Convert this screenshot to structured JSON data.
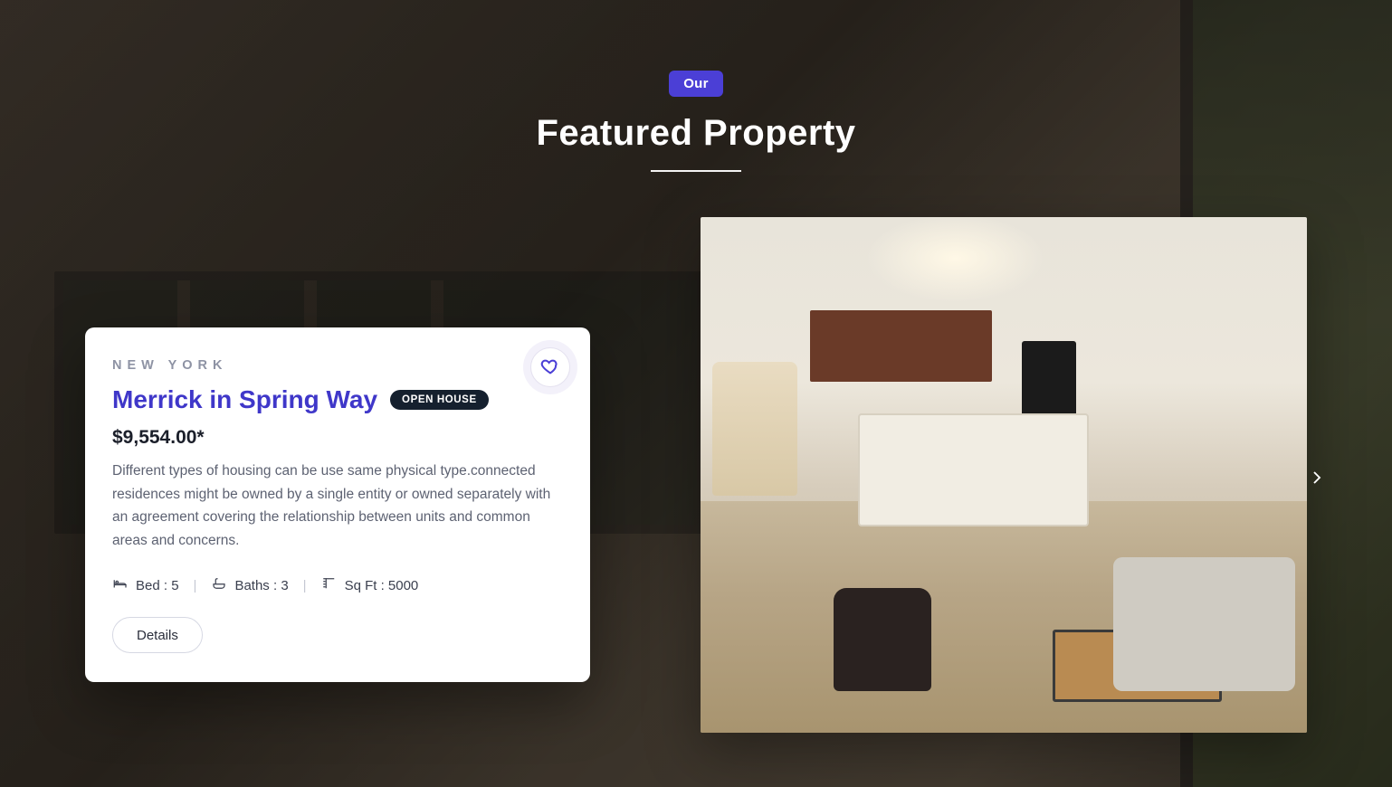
{
  "header": {
    "badge": "Our",
    "title": "Featured Property"
  },
  "property": {
    "location": "NEW YORK",
    "title": "Merrick in Spring Way",
    "status_pill": "OPEN HOUSE",
    "price": "$9,554.00*",
    "description": "Different types of housing can be use same physical type.connected residences might be owned by a single entity or owned separately with an agreement covering the relationship between units and common areas and concerns.",
    "meta": {
      "bed_label": "Bed : 5",
      "bath_label": "Baths : 3",
      "sqft_label": "Sq Ft : 5000"
    },
    "details_label": "Details"
  },
  "icons": {
    "favorite": "heart-icon",
    "next": "chevron-right-icon",
    "bed": "bed-icon",
    "bath": "bath-icon",
    "sqft": "ruler-icon"
  },
  "colors": {
    "accent": "#4b3fd6",
    "pill_bg": "#15202e",
    "title_link": "#3f37c9"
  }
}
